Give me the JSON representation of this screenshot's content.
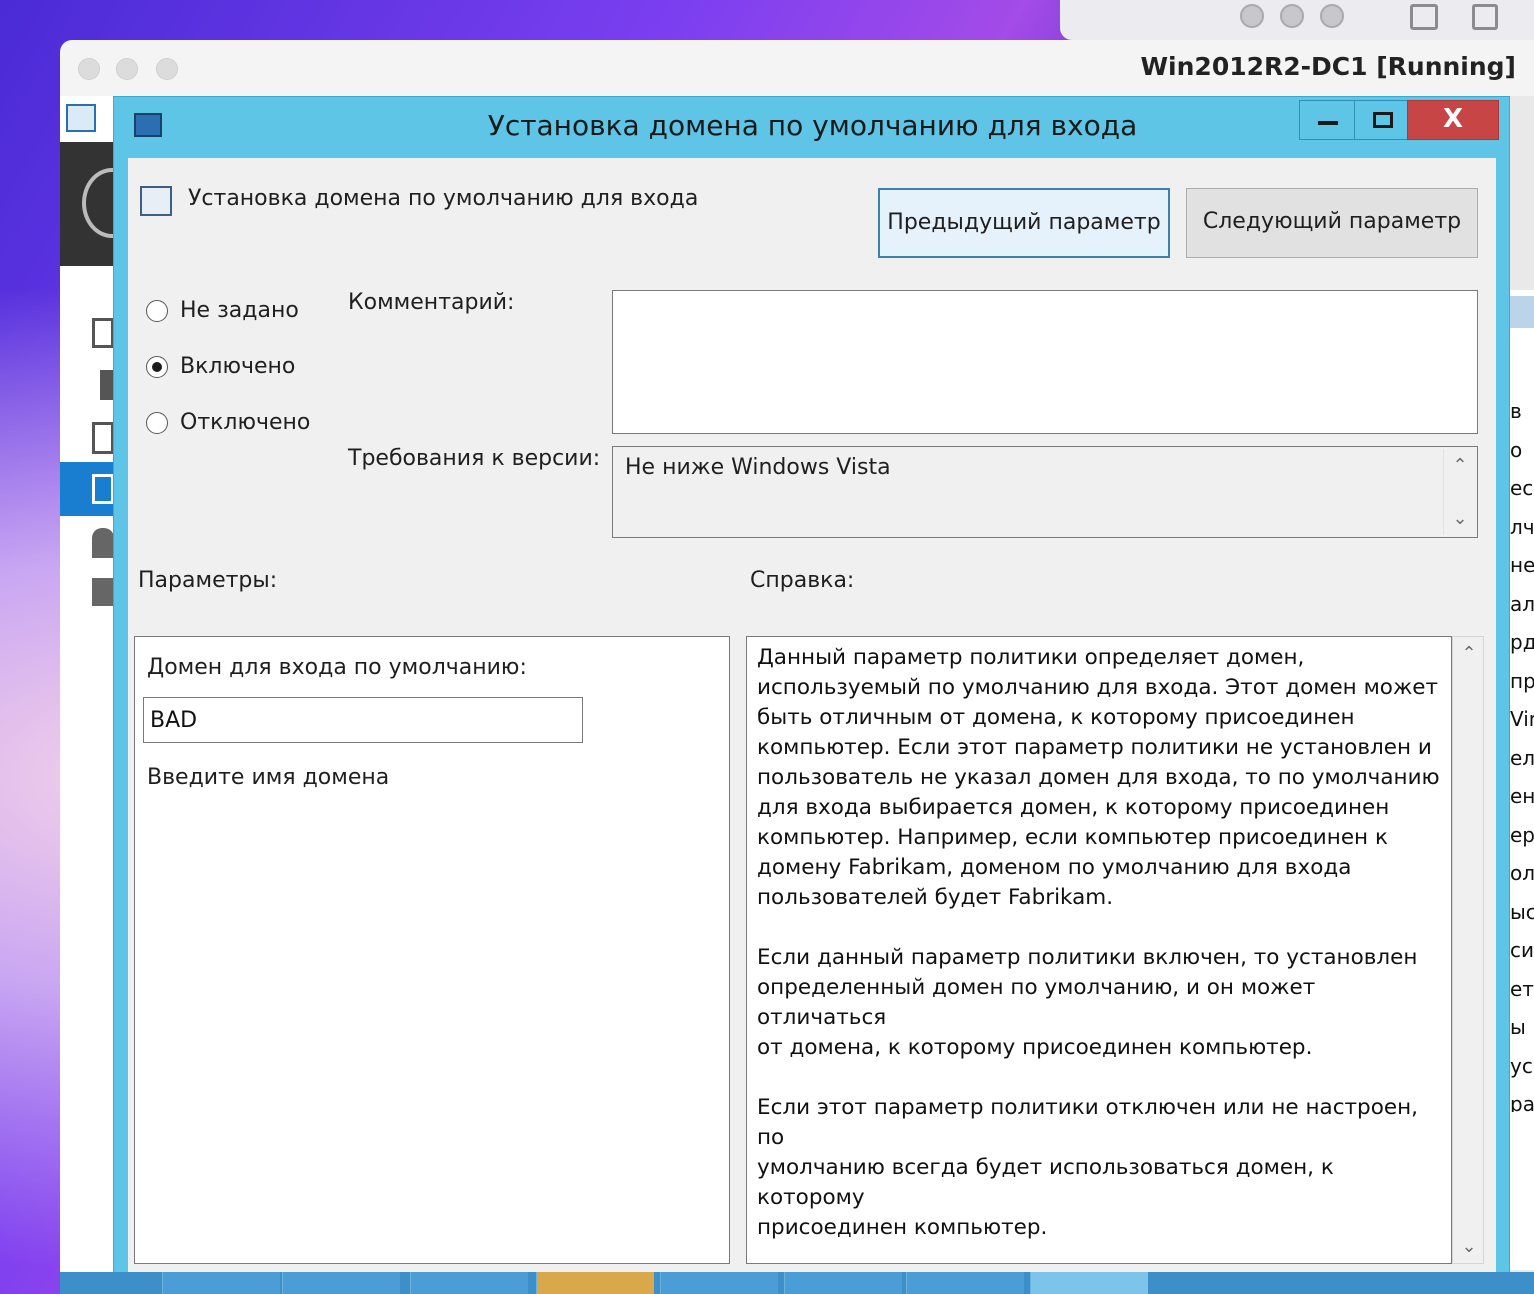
{
  "mac": {
    "window_title": "Win2012R2-DC1 [Running]"
  },
  "dialog": {
    "title": "Установка домена по умолчанию для входа",
    "close_label": "X",
    "setting_name": "Установка домена по умолчанию для входа",
    "prev_button": "Предыдущий параметр",
    "next_button": "Следующий параметр",
    "radios": [
      {
        "label": "Не задано",
        "checked": false
      },
      {
        "label": "Включено",
        "checked": true
      },
      {
        "label": "Отключено",
        "checked": false
      }
    ],
    "comment_label": "Комментарий:",
    "comment_value": "",
    "version_label": "Требования к версии:",
    "version_value": "Не ниже Windows Vista",
    "options_label": "Параметры:",
    "help_label": "Справка:",
    "options": {
      "domain_label": "Домен для входа по умолчанию:",
      "domain_value": "BAD",
      "domain_hint": "Введите имя домена"
    },
    "help_text": "Данный параметр политики определяет домен,\nиспользуемый по умолчанию для входа. Этот домен может\nбыть отличным от домена, к которому присоединен\nкомпьютер. Если этот параметр политики не установлен и\nпользователь не указал домен для входа, то по умолчанию\nдля входа выбирается домен, к которому присоединен\nкомпьютер. Например, если компьютер присоединен к\nдомену Fabrikam, доменом по умолчанию для входа\nпользователей будет Fabrikam.\n\nЕсли данный параметр политики включен, то установлен\nопределенный домен по умолчанию, и он может отличаться\nот домена, к которому присоединен компьютер.\n\nЕсли этот параметр политики отключен или не настроен, по\nумолчанию всегда будет использоваться домен, к которому\nприсоединен компьютер."
  },
  "background_snippets": [
    "в",
    "о",
    "ес",
    "лч",
    "не",
    "ал",
    "рд",
    "пр",
    "Vin",
    "ел",
    "ен",
    "ер",
    "ол",
    "ыс",
    "си",
    "ет",
    "ы",
    "ус",
    "ра"
  ],
  "colors": {
    "title_bar": "#5ec5e6",
    "close_button": "#c74545",
    "selected_nav": "#1a7ed0"
  }
}
